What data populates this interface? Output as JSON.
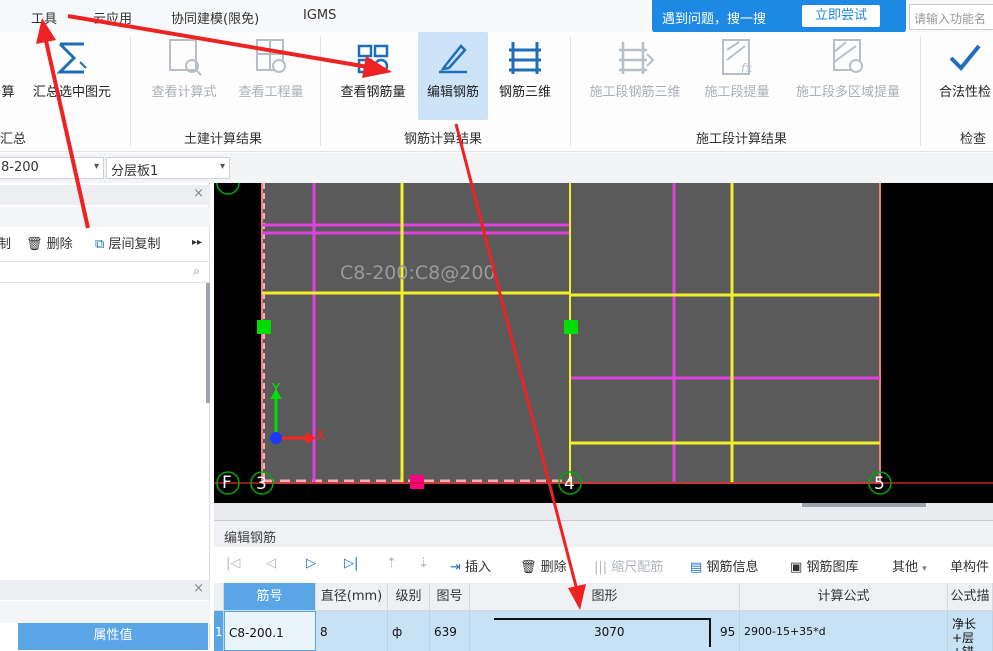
{
  "menu": {
    "items": [
      "工具",
      "云应用",
      "协同建模(限免)",
      "IGMS"
    ],
    "search_tip": "遇到问题，搜一搜",
    "search_button": "立即尝试",
    "search_placeholder": "请输入功能名"
  },
  "ribbon": {
    "buttons": [
      {
        "label": "算",
        "icon": "calc-icon",
        "enabled": true
      },
      {
        "label": "汇总选中图元",
        "icon": "sigma-icon",
        "enabled": true
      },
      {
        "label": "查看计算式",
        "icon": "view-formula-icon",
        "enabled": false
      },
      {
        "label": "查看工程量",
        "icon": "view-quantity-icon",
        "enabled": false
      },
      {
        "label": "查看钢筋量",
        "icon": "view-rebar-icon",
        "enabled": true
      },
      {
        "label": "编辑钢筋",
        "icon": "edit-rebar-icon",
        "enabled": true,
        "active": true
      },
      {
        "label": "钢筋三维",
        "icon": "rebar-3d-icon",
        "enabled": true
      },
      {
        "label": "施工段钢筋三维",
        "icon": "segment-rebar-3d-icon",
        "enabled": false
      },
      {
        "label": "施工段提量",
        "icon": "segment-quantity-icon",
        "enabled": false
      },
      {
        "label": "施工段多区域提量",
        "icon": "segment-multi-area-icon",
        "enabled": false
      },
      {
        "label": "合法性检",
        "icon": "check-icon",
        "enabled": true
      }
    ],
    "groups": [
      "汇总",
      "土建计算结果",
      "钢筋计算结果",
      "施工段计算结果",
      "检查"
    ]
  },
  "selectors": {
    "first": "8-200",
    "second": "分层板1"
  },
  "left_panel": {
    "toolbar": {
      "copy": "制",
      "delete": "删除",
      "floor_copy": "层间复制"
    },
    "property_value_header": "属性值"
  },
  "canvas": {
    "label": "C8-200:C8@200",
    "axis_x": "X",
    "axis_y": "Y",
    "grid_labels": [
      "F",
      "3",
      "4",
      "5"
    ],
    "colors": {
      "slab": "#5a5a5a",
      "rebar_magenta": "#e040e0",
      "rebar_yellow": "#f0f02a",
      "border_pink": "#f08080",
      "node_green": "#00dd00",
      "node_magenta": "#ff0080"
    }
  },
  "edit_panel": {
    "title": "编辑钢筋",
    "toolbar": {
      "insert": "插入",
      "delete": "删除",
      "scale": "缩尺配筋",
      "rebar_info": "钢筋信息",
      "rebar_library": "钢筋图库",
      "other": "其他",
      "single_component": "单构件"
    },
    "columns": [
      "筋号",
      "直径(mm)",
      "级别",
      "图号",
      "图形",
      "计算公式",
      "公式描"
    ],
    "rows": [
      {
        "index": "1",
        "bar_no": "C8-200.1",
        "diameter": "8",
        "grade": "ф",
        "figure_no": "639",
        "shape_length": "3070",
        "shape_hook": "95",
        "formula": "2900-15+35*d",
        "description": "净长+层+锚"
      }
    ]
  }
}
